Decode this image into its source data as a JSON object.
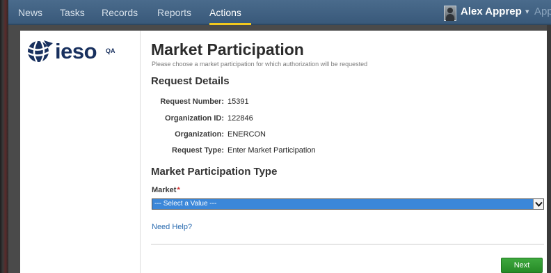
{
  "nav": {
    "items": [
      {
        "label": "News",
        "active": false
      },
      {
        "label": "Tasks",
        "active": false
      },
      {
        "label": "Records",
        "active": false
      },
      {
        "label": "Reports",
        "active": false
      },
      {
        "label": "Actions",
        "active": true
      }
    ],
    "user_name": "Alex Apprep",
    "user_caret": "▾",
    "app_logo": "Appia"
  },
  "brand": {
    "logo_text": "ieso",
    "environment_tag": "QA",
    "logo_color": "#18305e"
  },
  "page": {
    "title": "Market Participation",
    "subtitle": "Please choose a market participation for which authorization will be requested"
  },
  "request_details": {
    "heading": "Request Details",
    "fields": [
      {
        "label": "Request Number:",
        "value": "15391"
      },
      {
        "label": "Organization ID:",
        "value": "122846"
      },
      {
        "label": "Organization:",
        "value": "ENERCON"
      },
      {
        "label": "Request Type:",
        "value": "Enter Market Participation"
      }
    ]
  },
  "market_type": {
    "heading": "Market Participation Type",
    "market_label": "Market",
    "required_marker": "*",
    "select_value": "--- Select a Value ---",
    "help_link": "Need Help?"
  },
  "actions": {
    "next_label": "Next"
  },
  "colors": {
    "nav_bar": "#39597a",
    "active_tab_underline": "#f2c81e",
    "select_highlight": "#3b87d9",
    "next_button": "#2e962e",
    "required": "#d22c2c"
  },
  "icons": {
    "brand_mark": "globe-logo-icon",
    "select_dropdown": "chevron-down-icon",
    "avatar": "user-avatar-icon"
  }
}
